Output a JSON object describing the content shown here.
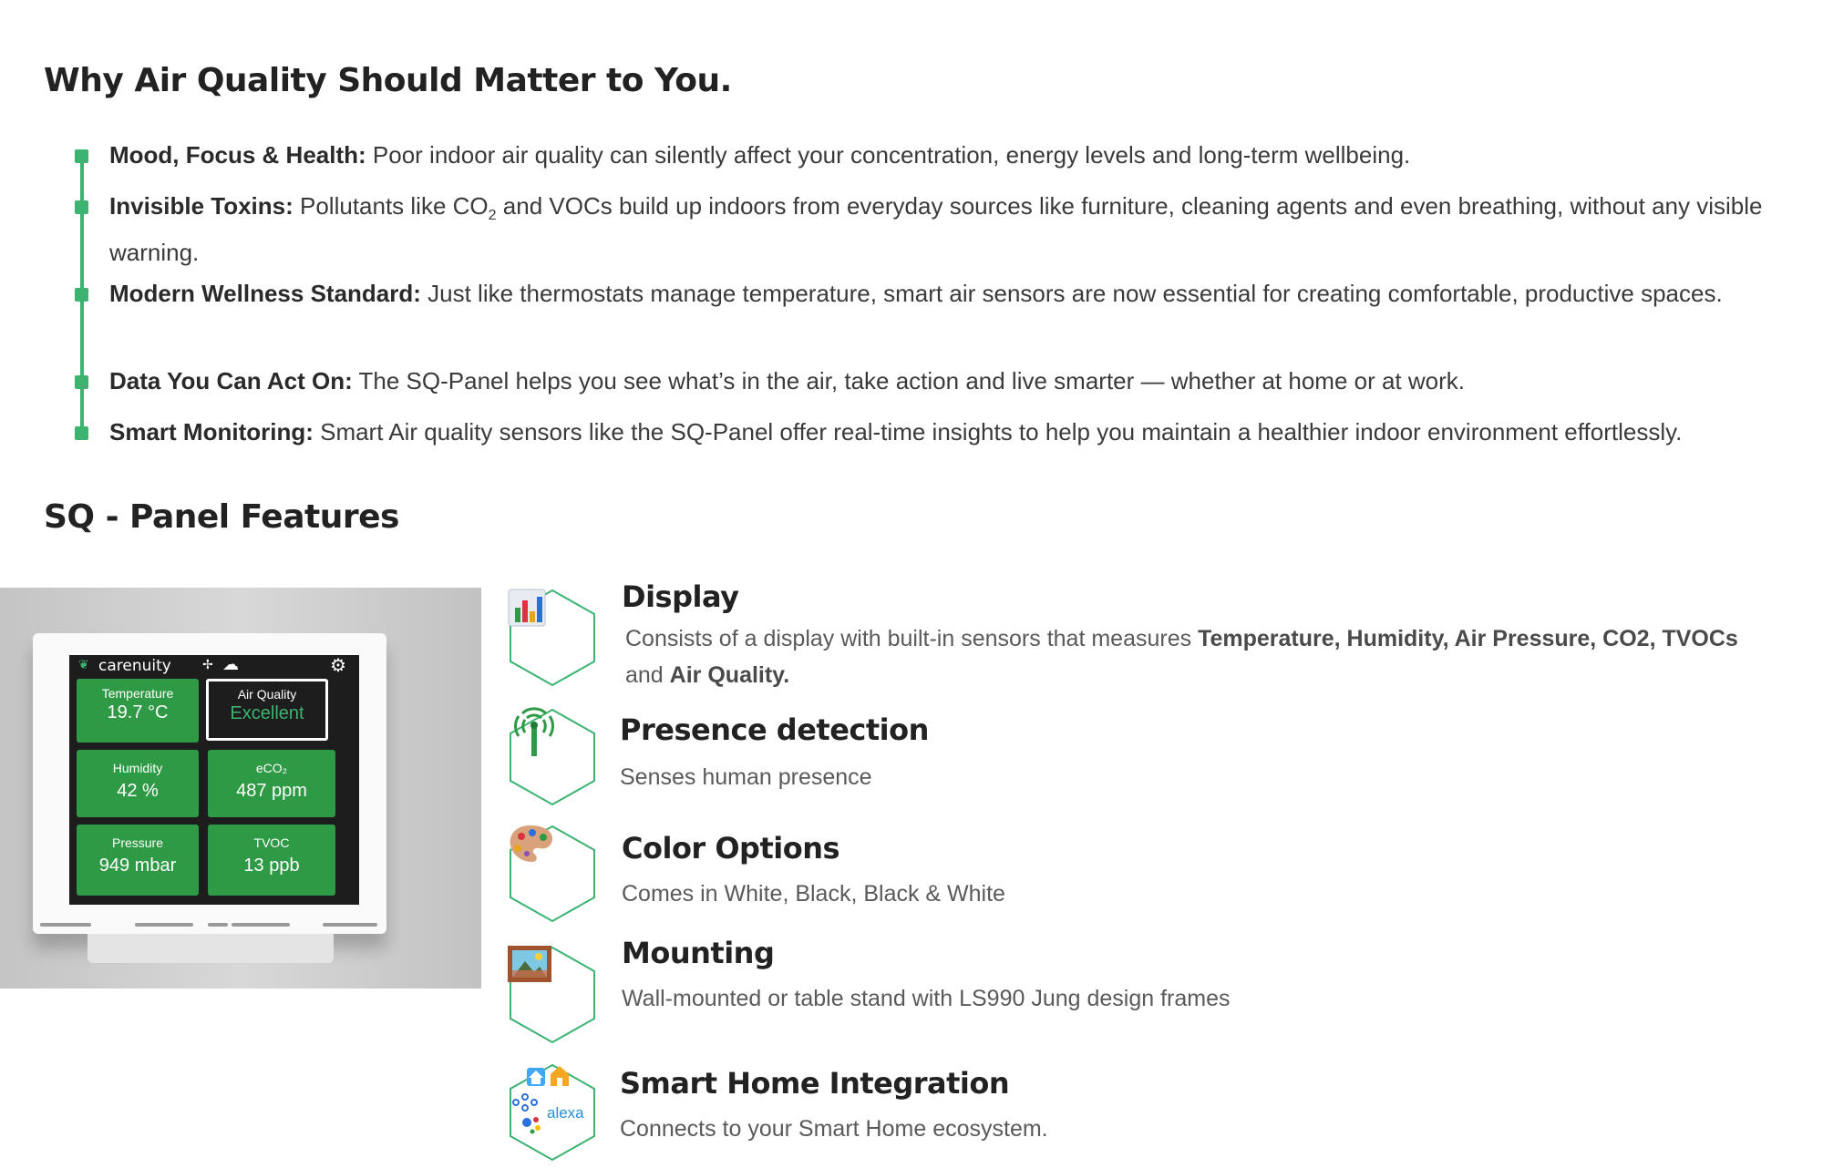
{
  "section1": {
    "title": "Why Air Quality Should Matter to You.",
    "bullets": [
      {
        "label": "Mood, Focus & Health:",
        "text": " Poor indoor air quality can silently affect your concentration, energy levels and long-term wellbeing."
      },
      {
        "label": "Invisible Toxins:",
        "text_a": " Pollutants like CO",
        "sub": "2",
        "text_b": " and VOCs build up indoors from everyday sources like furniture, cleaning agents and even breathing, without any visible warning."
      },
      {
        "label": "Modern Wellness Standard:",
        "text": " Just like thermostats manage temperature, smart air sensors are now essential for creating comfortable, productive spaces."
      },
      {
        "label": "Data You Can Act On:",
        "text": " The SQ-Panel helps you see what’s in the air, take action and live smarter — whether at home or at work."
      },
      {
        "label": "Smart Monitoring:",
        "text": " Smart Air quality sensors like the SQ-Panel offer real-time insights to help you maintain a healthier indoor environment effortlessly."
      }
    ]
  },
  "section2": {
    "title": "SQ - Panel Features"
  },
  "device": {
    "brand": "carenuity",
    "tiles": {
      "temperature": {
        "label": "Temperature",
        "value": "19.7 °C"
      },
      "air_quality": {
        "label": "Air Quality",
        "value": "Excellent"
      },
      "humidity": {
        "label": "Humidity",
        "value": "42 %"
      },
      "eco2": {
        "label": "eCO₂",
        "value": "487 ppm"
      },
      "pressure": {
        "label": "Pressure",
        "value": "949 mbar"
      },
      "tvoc": {
        "label": "TVOC",
        "value": "13 ppb"
      }
    }
  },
  "features": [
    {
      "icon": "bar-chart-icon",
      "title": "Display",
      "desc_a": "Consists of a display with built-in sensors that measures ",
      "desc_bold_a": "Temperature, Humidity, Air Pressure, CO2, TVOCs",
      "desc_b": " and ",
      "desc_bold_b": "Air Quality."
    },
    {
      "icon": "antenna-icon",
      "title": "Presence detection",
      "desc": "Senses human presence"
    },
    {
      "icon": "palette-icon",
      "title": "Color Options",
      "desc": "Comes in White, Black, Black & White"
    },
    {
      "icon": "framed-picture-icon",
      "title": "Mounting",
      "desc": "Wall-mounted or table stand with LS990 Jung design frames"
    },
    {
      "icon": "smart-home-icon",
      "title": "Smart Home Integration",
      "desc": "Connects to your Smart Home ecosystem.",
      "badge_alexa": "alexa"
    }
  ],
  "colors": {
    "accent": "#3cb371",
    "tile": "#2e9a45",
    "hex_outline": "#3cb371"
  }
}
